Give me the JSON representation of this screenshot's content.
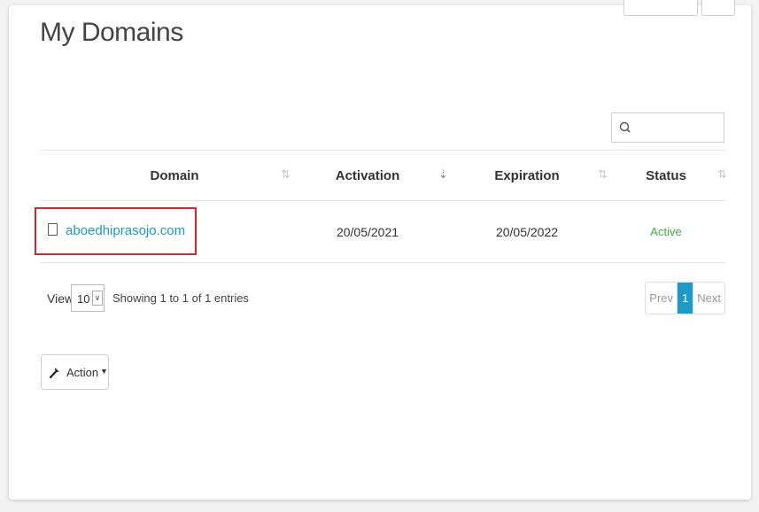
{
  "page": {
    "title": "My Domains"
  },
  "search": {
    "placeholder": "",
    "value": ""
  },
  "table": {
    "columns": [
      "Domain",
      "Activation",
      "Expiration",
      "Status"
    ],
    "rows": [
      {
        "domain": "aboedhiprasojo.com",
        "activation": "20/05/2021",
        "expiration": "20/05/2022",
        "status": "Active"
      }
    ]
  },
  "footer": {
    "view_label": "View",
    "page_size": "10",
    "showing": "Showing 1 to 1 of 1 entries",
    "prev_label": "Prev",
    "current_page": "1",
    "next_label": "Next"
  },
  "action": {
    "label": "Action"
  },
  "colors": {
    "accent": "#1a9bc9",
    "status_active": "#3cb03c",
    "highlight": "#d9262b"
  },
  "icons": {
    "search": "search-icon",
    "sort": "sort-icon",
    "wrench": "wrench-icon",
    "caret": "caret-down-icon"
  }
}
